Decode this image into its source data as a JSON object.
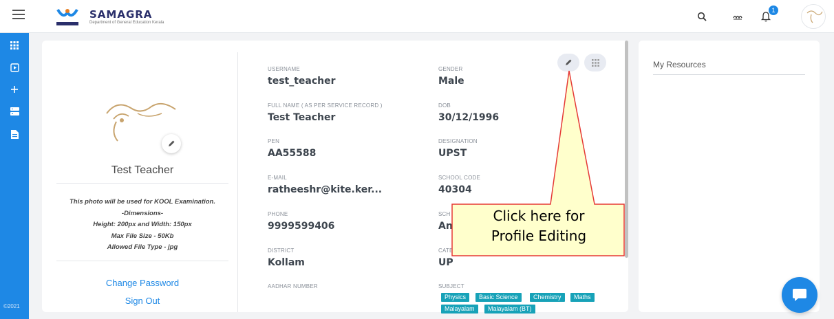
{
  "app": {
    "brand_name": "SAMAGRA",
    "brand_subtitle": "Department of General Education Kerala",
    "notification_count": "1",
    "year": "©2021"
  },
  "profile": {
    "name": "Test Teacher",
    "photo_note_lines": [
      "This photo will be used for KOOL Examination.",
      "-Dimensions-",
      "Height: 200px and Width: 150px",
      "Max File Size - 50Kb",
      "Allowed File Type - jpg"
    ],
    "change_password": "Change Password",
    "sign_out": "Sign Out"
  },
  "fields": {
    "username": {
      "label": "USERNAME",
      "value": "test_teacher"
    },
    "gender": {
      "label": "GENDER",
      "value": "Male"
    },
    "full_name": {
      "label": "FULL NAME ( AS PER SERVICE RECORD )",
      "value": "Test Teacher"
    },
    "dob": {
      "label": "DOB",
      "value": "30/12/1996"
    },
    "pen": {
      "label": "PEN",
      "value": "AA55588"
    },
    "designation": {
      "label": "DESIGNATION",
      "value": "UPST"
    },
    "email": {
      "label": "E-MAIL",
      "value": "ratheeshr@kite.ker..."
    },
    "school_code": {
      "label": "SCHOOL CODE",
      "value": "40304"
    },
    "phone": {
      "label": "PHONE",
      "value": "9999599406"
    },
    "school": {
      "label": "SCH",
      "value": "An"
    },
    "district": {
      "label": "DISTRICT",
      "value": "Kollam"
    },
    "category": {
      "label": "CATE",
      "value": "UP"
    },
    "aadhar": {
      "label": "AADHAR NUMBER",
      "value": ""
    },
    "subject": {
      "label": "SUBJECT"
    }
  },
  "subjects": [
    "Physics",
    "Basic Science",
    "Chemistry",
    "Maths",
    "Malayalam",
    "Malayalam (BT)"
  ],
  "resources": {
    "title": "My Resources"
  },
  "callout": {
    "line1": "Click here for",
    "line2": "Profile Editing"
  },
  "colors": {
    "sidebar": "#1e88e5",
    "tag": "#17a2b8",
    "callout_fill": "#ffffcc",
    "callout_border": "#e53935"
  }
}
